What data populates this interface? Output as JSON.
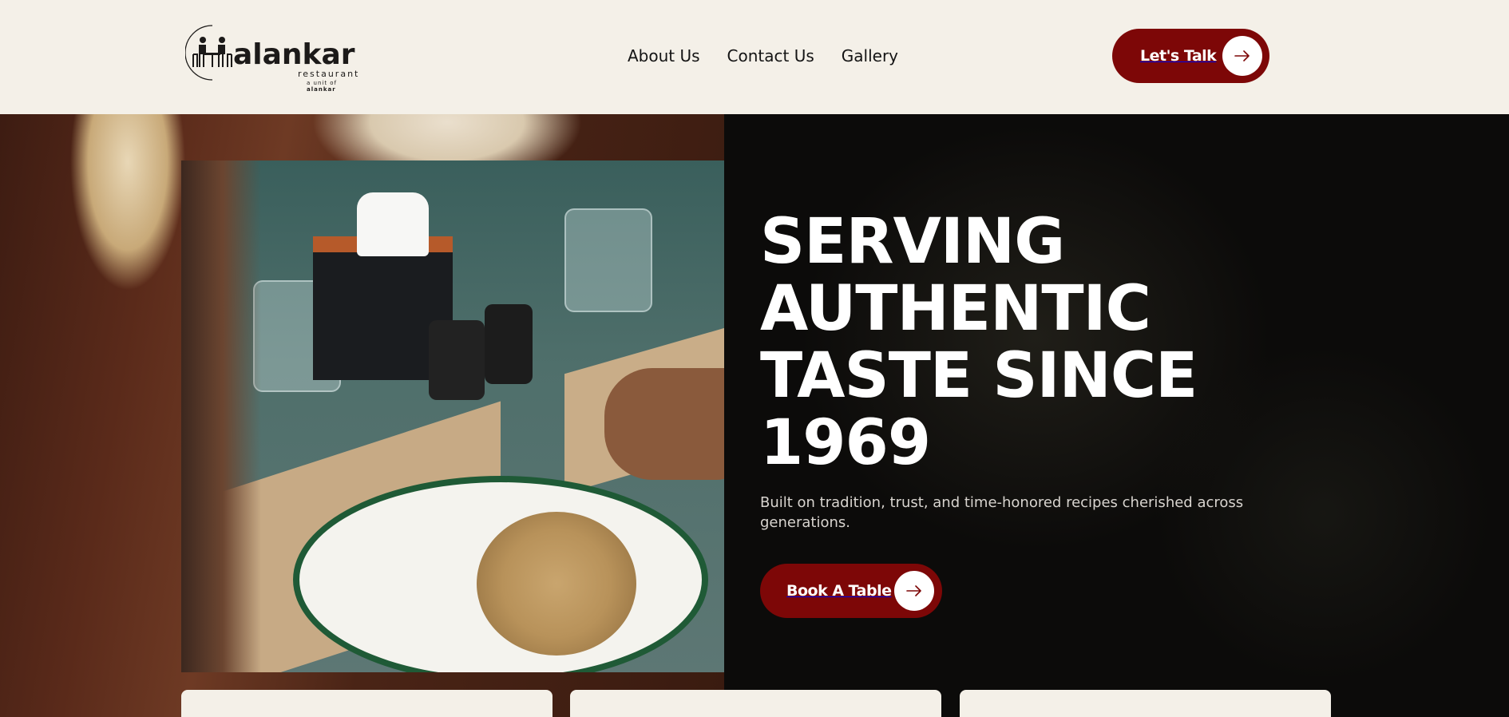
{
  "logo": {
    "wordmark": "alankar",
    "subtitle": "restaurant",
    "unit_prefix": "a unit of",
    "unit_brand": "alankar",
    "icon": "diners-at-table-logo"
  },
  "nav": {
    "items": [
      {
        "label": "About Us"
      },
      {
        "label": "Contact Us"
      },
      {
        "label": "Gallery"
      }
    ]
  },
  "header": {
    "cta_label": "Let's Talk",
    "cta_icon": "arrow-right-icon"
  },
  "hero": {
    "headline_lines": [
      "SERVING",
      "AUTHENTIC",
      "TASTE SINCE",
      "1969"
    ],
    "subtext": "Built on tradition, trust, and time-honored recipes cherished across generations.",
    "cta_label": "Book A Table",
    "cta_icon": "arrow-right-icon"
  },
  "colors": {
    "brand": "#7d0707",
    "background": "#f4f0e8",
    "hero_dark": "#0c0b0a",
    "text_light": "#ffffff"
  }
}
